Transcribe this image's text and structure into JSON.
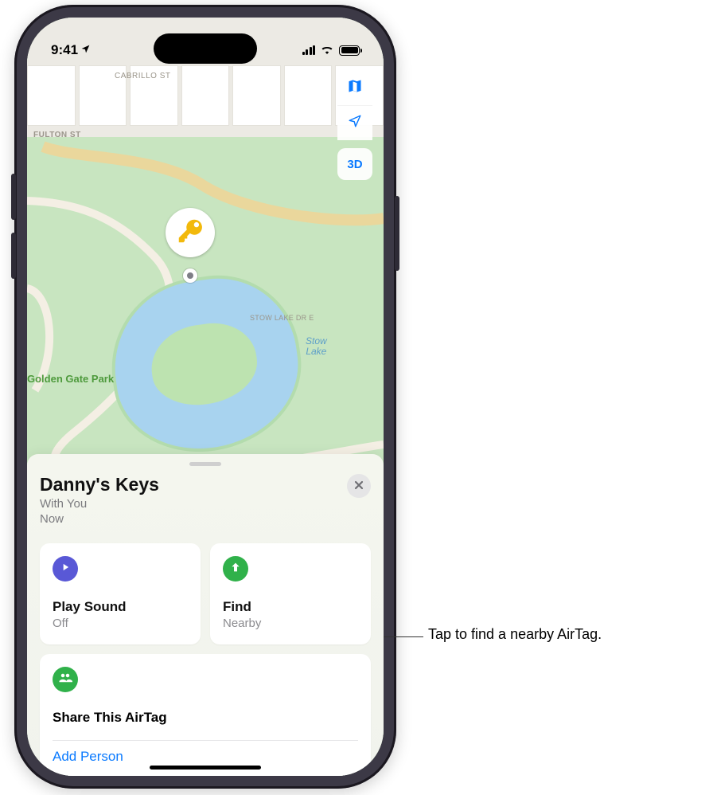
{
  "status": {
    "time": "9:41",
    "location_arrow": "↗"
  },
  "map": {
    "streets": {
      "cabrillo": "Cabrillo St",
      "fulton": "Fulton St",
      "stow_e": "Stow Lake Dr E",
      "stow": "Stow Lake Dr"
    },
    "park": "Golden Gate Park",
    "lake": "Stow\nLake",
    "controls": {
      "maps": "maps-icon",
      "location": "location-icon",
      "three_d": "3D"
    },
    "pin_icon": "key-icon"
  },
  "sheet": {
    "title": "Danny's Keys",
    "status_line": "With You",
    "time_line": "Now",
    "close": "✕",
    "cards": {
      "play": {
        "title": "Play Sound",
        "sub": "Off"
      },
      "find": {
        "title": "Find",
        "sub": "Nearby"
      }
    },
    "share": {
      "title": "Share This AirTag",
      "add": "Add Person"
    }
  },
  "callout": {
    "text": "Tap to find a nearby AirTag."
  }
}
